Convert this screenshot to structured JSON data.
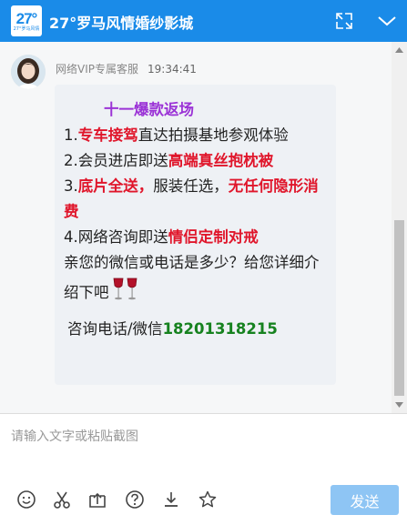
{
  "header": {
    "logo_text": "27°",
    "logo_sub": "27°罗马风情",
    "title": "27°罗马风情婚纱影城"
  },
  "message": {
    "sender": "网络VIP专属客服",
    "time": "19:34:41",
    "headline": "十一爆款返场",
    "lines": {
      "l1_prefix": "1.",
      "l1_red": "专车接驾",
      "l1_rest": "直达拍摄基地参观体验",
      "l2_prefix": "2.会员进店即送",
      "l2_red": "高端真丝抱枕被",
      "l3_prefix": "3.",
      "l3_red": "底片全送，",
      "l3_mid": "服装任选，",
      "l3_red2": "无任何隐形消费",
      "l4_prefix": "4.网络咨询即送",
      "l4_red": "情侣定制对戒",
      "l5": "亲您的微信或电话是多少？给您详细介绍下吧",
      "phone_label": "咨询电话/微信",
      "phone_number": "18201318215"
    }
  },
  "input": {
    "placeholder": "请输入文字或粘贴截图"
  },
  "toolbar": {
    "icons": [
      "emoji-icon",
      "scissors-icon",
      "upload-icon",
      "help-icon",
      "download-icon",
      "star-icon"
    ],
    "send_label": "发送"
  },
  "colors": {
    "header_bg": "#1a8be8",
    "headline": "#9b33d6",
    "highlight_red": "#e0162b",
    "phone_green": "#16821f",
    "send_bg": "#8ec5f4"
  }
}
